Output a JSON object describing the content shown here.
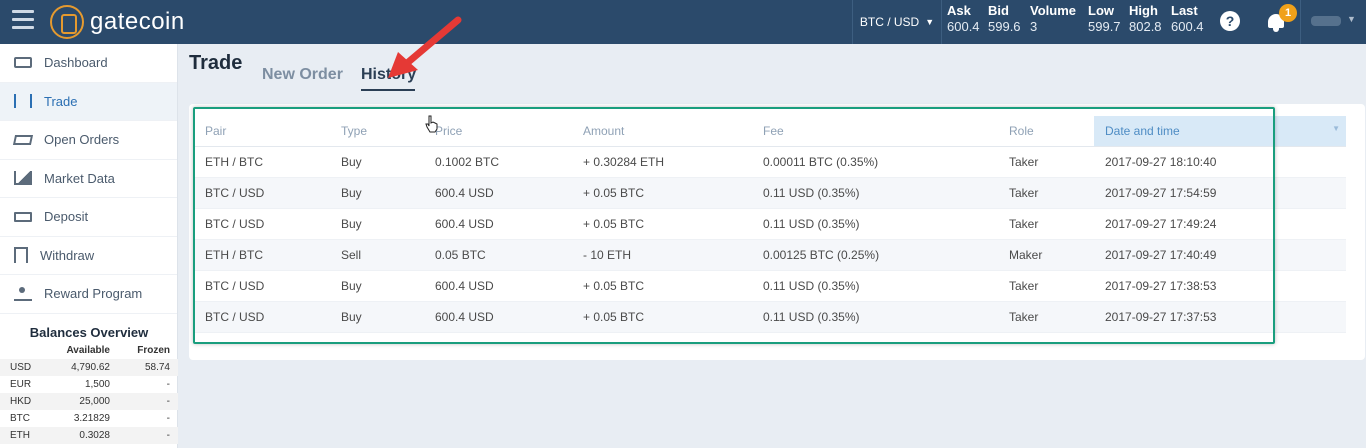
{
  "header": {
    "logo_text": "gatecoin",
    "pair": "BTC / USD",
    "stats": [
      {
        "label": "Ask",
        "value": "600.4"
      },
      {
        "label": "Bid",
        "value": "599.6"
      },
      {
        "label": "Volume",
        "value": "3"
      },
      {
        "label": "Low",
        "value": "599.7"
      },
      {
        "label": "High",
        "value": "802.8"
      },
      {
        "label": "Last",
        "value": "600.4"
      }
    ],
    "help_label": "?",
    "notification_count": "1",
    "accent_color": "#f0a11a",
    "bar_color": "#2b4a6b"
  },
  "sidebar": {
    "items": [
      {
        "label": "Dashboard",
        "icon": "monitor-icon"
      },
      {
        "label": "Trade",
        "icon": "trade-icon",
        "active": true
      },
      {
        "label": "Open Orders",
        "icon": "orders-icon"
      },
      {
        "label": "Market Data",
        "icon": "chart-icon"
      },
      {
        "label": "Deposit",
        "icon": "deposit-icon"
      },
      {
        "label": "Withdraw",
        "icon": "withdraw-icon"
      },
      {
        "label": "Reward Program",
        "icon": "reward-icon"
      }
    ]
  },
  "balances": {
    "title": "Balances Overview",
    "headers": {
      "available": "Available",
      "frozen": "Frozen"
    },
    "rows": [
      {
        "currency": "USD",
        "available": "4,790.62",
        "frozen": "58.74"
      },
      {
        "currency": "EUR",
        "available": "1,500",
        "frozen": "-"
      },
      {
        "currency": "HKD",
        "available": "25,000",
        "frozen": "-"
      },
      {
        "currency": "BTC",
        "available": "3.21829",
        "frozen": "-"
      },
      {
        "currency": "ETH",
        "available": "0.3028",
        "frozen": "-"
      }
    ]
  },
  "main": {
    "title": "Trade",
    "tabs": {
      "new_order": "New Order",
      "history": "History"
    },
    "table": {
      "columns": [
        "Pair",
        "Type",
        "Price",
        "Amount",
        "Fee",
        "Role",
        "Date and time"
      ],
      "rows": [
        [
          "ETH / BTC",
          "Buy",
          "0.1002 BTC",
          "+ 0.30284 ETH",
          "0.00011 BTC (0.35%)",
          "Taker",
          "2017-09-27 18:10:40"
        ],
        [
          "BTC / USD",
          "Buy",
          "600.4 USD",
          "+ 0.05 BTC",
          "0.11 USD (0.35%)",
          "Taker",
          "2017-09-27 17:54:59"
        ],
        [
          "BTC / USD",
          "Buy",
          "600.4 USD",
          "+ 0.05 BTC",
          "0.11 USD (0.35%)",
          "Taker",
          "2017-09-27 17:49:24"
        ],
        [
          "ETH / BTC",
          "Sell",
          "0.05 BTC",
          "- 10 ETH",
          "0.00125 BTC (0.25%)",
          "Maker",
          "2017-09-27 17:40:49"
        ],
        [
          "BTC / USD",
          "Buy",
          "600.4 USD",
          "+ 0.05 BTC",
          "0.11 USD (0.35%)",
          "Taker",
          "2017-09-27 17:38:53"
        ],
        [
          "BTC / USD",
          "Buy",
          "600.4 USD",
          "+ 0.05 BTC",
          "0.11 USD (0.35%)",
          "Taker",
          "2017-09-27 17:37:53"
        ]
      ]
    },
    "highlight_color": "#1a9e7e",
    "arrow_color": "#e53935"
  }
}
